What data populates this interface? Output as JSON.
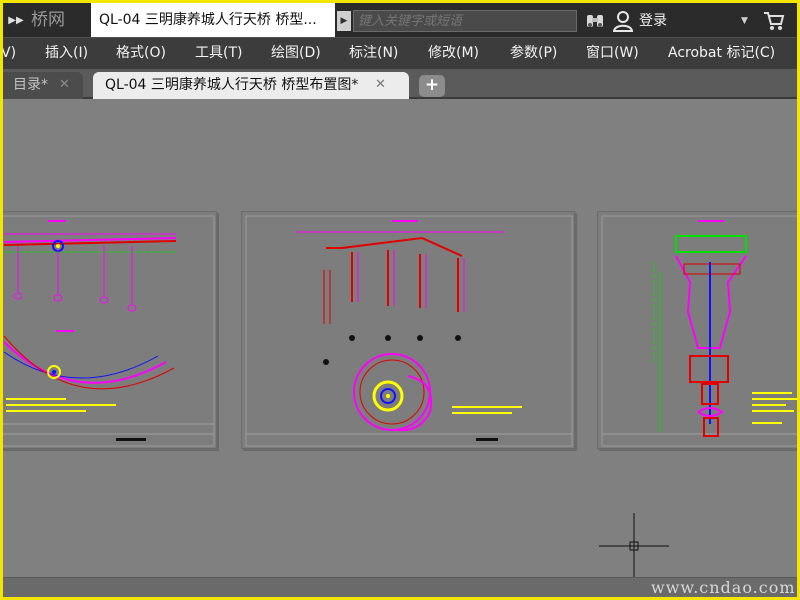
{
  "titlebar": {
    "brand": "桥网",
    "document_title": "QL-04 三明康养城人行天桥 桥型...",
    "search_placeholder": "键入关键字或短语",
    "login_label": "登录"
  },
  "menu": [
    "V)",
    "插入(I)",
    "格式(O)",
    "工具(T)",
    "绘图(D)",
    "标注(N)",
    "修改(M)",
    "参数(P)",
    "窗口(W)",
    "Acrobat 标记(C)"
  ],
  "tabs": [
    {
      "label": "目录*",
      "close": "✕",
      "active": false
    },
    {
      "label": "QL-04 三明康养城人行天桥 桥型布置图*",
      "close": "✕",
      "active": true
    }
  ],
  "tab_add_label": "+",
  "watermark": "www.cndao.com",
  "colors": {
    "canvas": "#808080",
    "frame_border": "#f2e600",
    "cad_magenta": "#ff00ff",
    "cad_red": "#e00000",
    "cad_green": "#00e000",
    "cad_yellow": "#ffff00",
    "cad_blue": "#1010ff"
  },
  "icons": {
    "qa_toggle": "chevron-double-right-icon",
    "search_arrow": "triangle-right-icon",
    "find": "binoculars-icon",
    "user": "user-icon",
    "dropdown": "caret-down-icon",
    "cart": "cart-icon",
    "cursor": "crosshair-cursor-icon"
  }
}
